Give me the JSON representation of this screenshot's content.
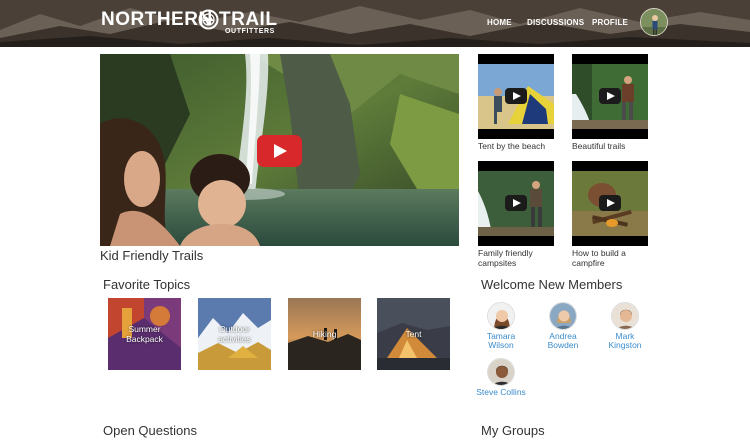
{
  "header": {
    "logo_word_1": "NORTHERN",
    "logo_word_2": "TRAIL",
    "logo_sub": "OUTFITTERS",
    "nav": {
      "home": "HOME",
      "discussions": "DISCUSSIONS",
      "profile": "PROFILE"
    },
    "colors": {
      "bar": "#3e3630",
      "text": "#ffffff"
    }
  },
  "main_video": {
    "title": "Kid Friendly Trails",
    "play_color": "#d8282b"
  },
  "videos": [
    {
      "title": "Tent by the beach",
      "icon": "play-icon"
    },
    {
      "title": "Beautiful trails",
      "icon": "play-icon"
    },
    {
      "title": "Family friendly campsites",
      "icon": "play-icon"
    },
    {
      "title": "How to build a campfire",
      "icon": "play-icon"
    }
  ],
  "favorite_topics": {
    "heading": "Favorite Topics",
    "items": [
      {
        "label": "Summer Backpack"
      },
      {
        "label": "Outdoor activities"
      },
      {
        "label": "Hiking"
      },
      {
        "label": "Tent"
      }
    ]
  },
  "members": {
    "heading": "Welcome New Members",
    "link_color": "#3b8ccc",
    "items": [
      {
        "name": "Tamara Wilson"
      },
      {
        "name": "Andrea Bowden"
      },
      {
        "name": "Mark Kingston"
      },
      {
        "name": "Steve Collins"
      }
    ]
  },
  "open_questions": {
    "heading": "Open Questions"
  },
  "my_groups": {
    "heading": "My Groups"
  }
}
